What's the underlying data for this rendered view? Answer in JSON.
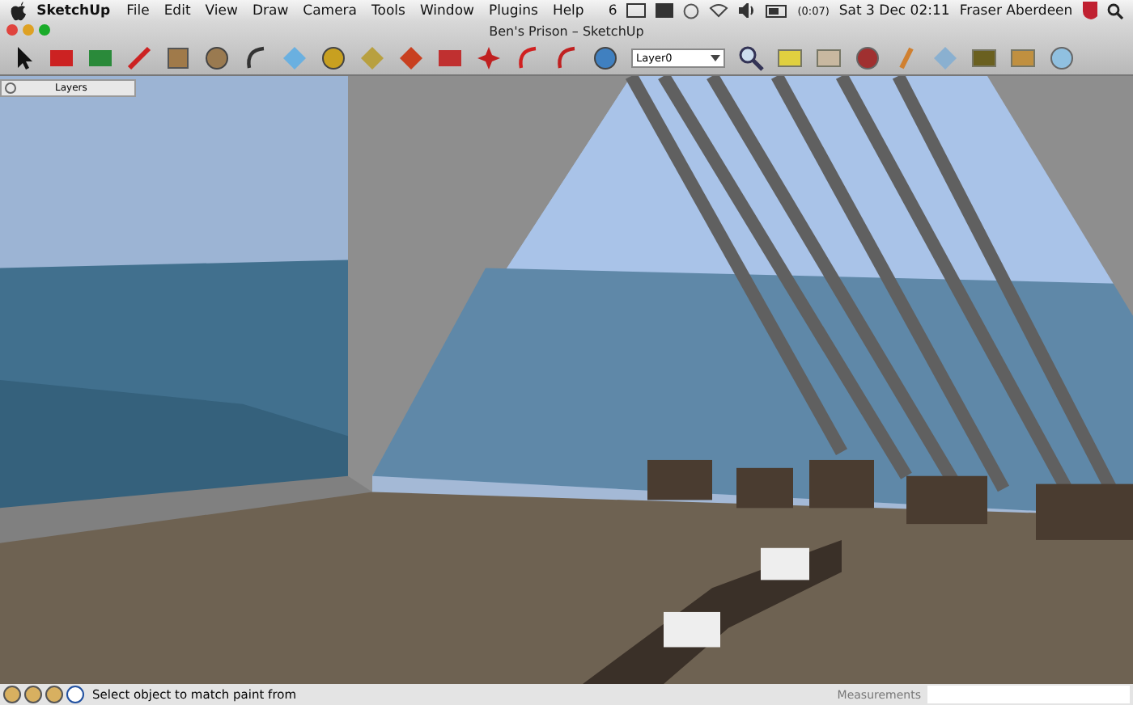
{
  "menu_bar": {
    "app_name": "SketchUp",
    "items": [
      "File",
      "Edit",
      "View",
      "Draw",
      "Camera",
      "Tools",
      "Window",
      "Plugins",
      "Help"
    ],
    "status": {
      "adobe_count": "6",
      "battery_time": "(0:07)",
      "clock": "Sat 3 Dec  02:11",
      "user": "Fraser Aberdeen"
    }
  },
  "window": {
    "title": "Ben's Prison – SketchUp"
  },
  "toolbar": {
    "layer_dropdown": {
      "value": "Layer0"
    }
  },
  "layers_panel": {
    "title": "Layers"
  },
  "status_bar": {
    "message": "Select object to match paint from",
    "measurements_label": "Measurements"
  }
}
